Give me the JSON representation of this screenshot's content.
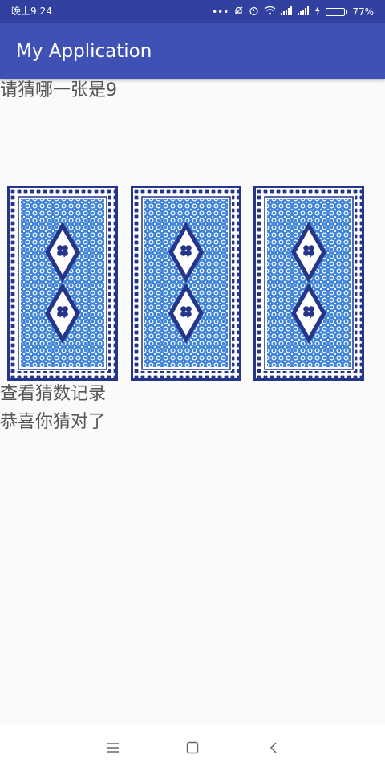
{
  "status_bar": {
    "time": "晚上9:24",
    "battery_percent": "77%",
    "battery_level": 0.77,
    "icons": [
      "more-dots-icon",
      "mute-bell-icon",
      "alarm-icon",
      "wifi-icon",
      "signal-icon",
      "signal-icon",
      "charging-icon",
      "battery-icon"
    ]
  },
  "app_bar": {
    "title": "My Application"
  },
  "main": {
    "prompt": "请猜哪一张是9",
    "cards": [
      {
        "icon": "card-back-icon"
      },
      {
        "icon": "card-back-icon"
      },
      {
        "icon": "card-back-icon"
      }
    ],
    "history_link": "查看猜数记录",
    "result": "恭喜你猜对了"
  },
  "nav_bar": {
    "icons": [
      "menu-icon",
      "home-icon",
      "back-icon"
    ]
  },
  "colors": {
    "status_bar": "#3240a0",
    "app_bar": "#3f51b5",
    "card_dark": "#24358a",
    "card_light": "#3f84d8"
  }
}
